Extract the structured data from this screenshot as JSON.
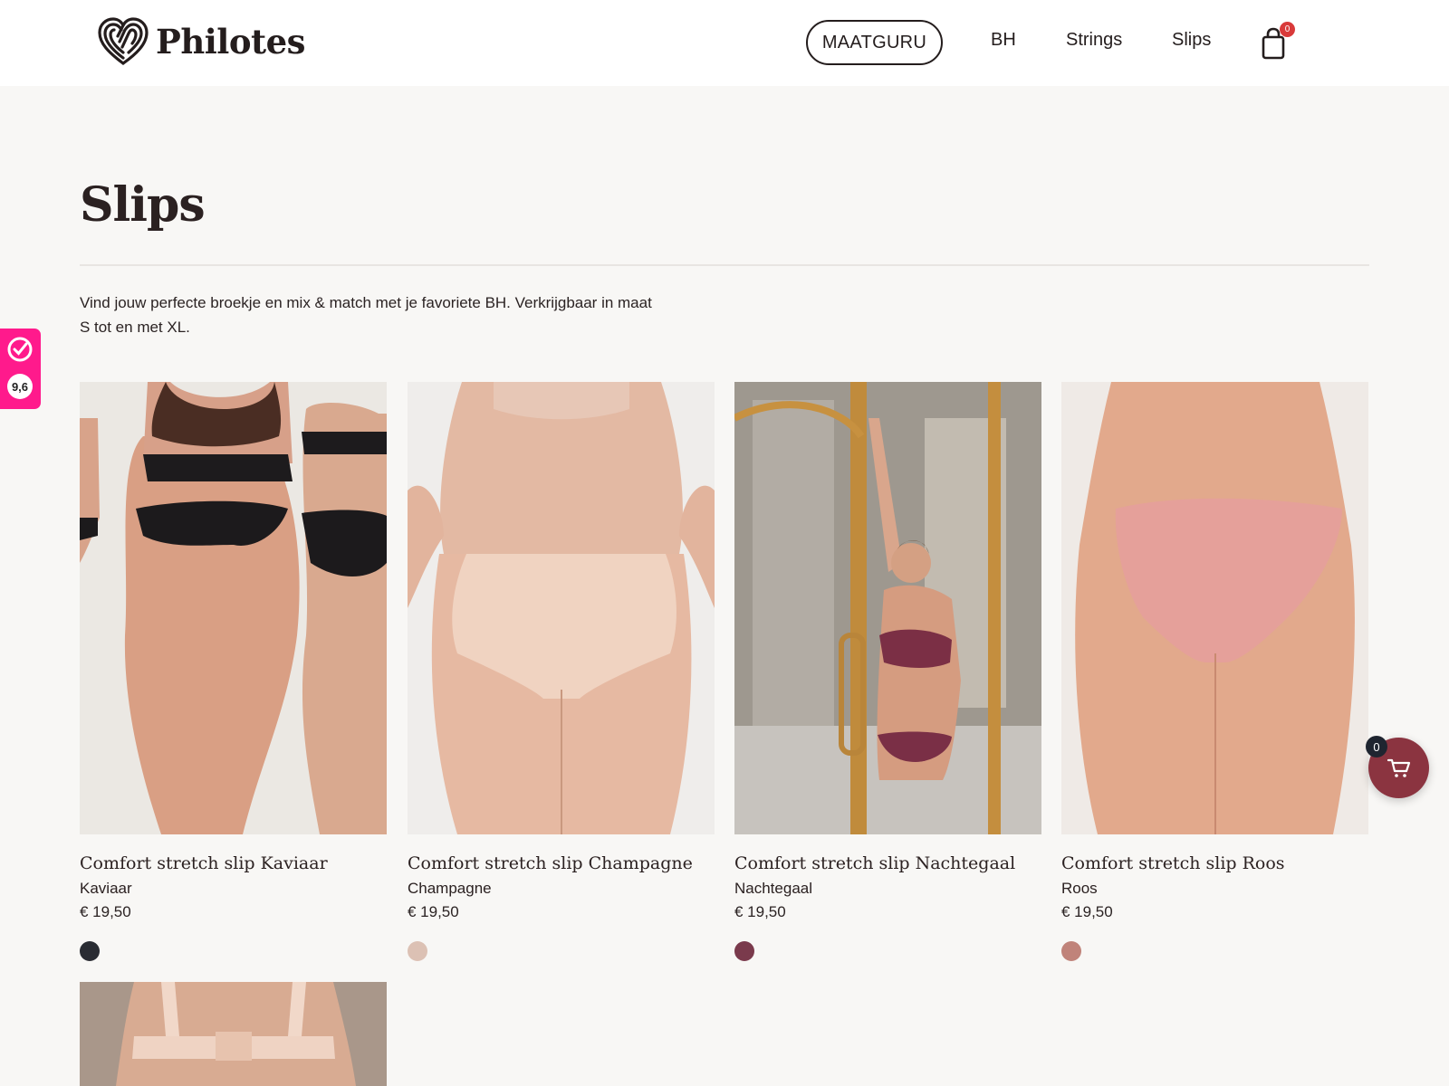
{
  "header": {
    "brand": "Philotes",
    "nav": {
      "maatguru": "MAATGURU",
      "bh": "BH",
      "strings": "Strings",
      "slips": "Slips"
    },
    "cart_count": "0"
  },
  "page": {
    "title": "Slips",
    "intro": "Vind jouw perfecte broekje en mix & match met je favoriete BH. Verkrijgbaar in maat S tot en met XL."
  },
  "review_widget": {
    "score": "9,6",
    "color": "#ff1a8c"
  },
  "products": [
    {
      "title": "Comfort stretch slip Kaviaar",
      "variant": "Kaviaar",
      "price": "€ 19,50",
      "swatch": "#2a2c33"
    },
    {
      "title": "Comfort stretch slip Champagne",
      "variant": "Champagne",
      "price": "€ 19,50",
      "swatch": "#dcc1b4"
    },
    {
      "title": "Comfort stretch slip Nachtegaal",
      "variant": "Nachtegaal",
      "price": "€ 19,50",
      "swatch": "#7a3a4c"
    },
    {
      "title": "Comfort stretch slip Roos",
      "variant": "Roos",
      "price": "€ 19,50",
      "swatch": "#c0837a"
    }
  ],
  "floating_cart": {
    "count": "0",
    "color": "#8b3440"
  }
}
